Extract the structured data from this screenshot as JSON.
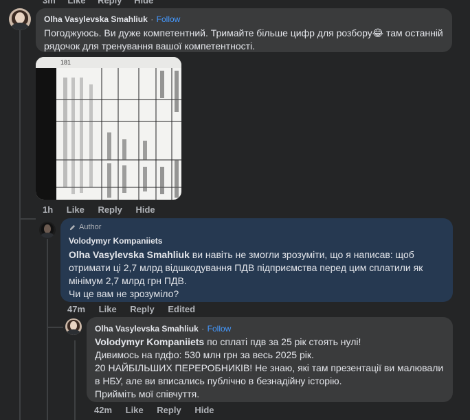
{
  "top_actions": [
    "3m",
    "Like",
    "Reply",
    "Hide"
  ],
  "comment1": {
    "author": "Olha Vasylevska Smahliuk",
    "sep": "·",
    "follow": "Follow",
    "text": "Погоджуюсь. Ви дуже компетентний. Тримайте більше цифр для розбору😂 там останній рядочок для тренування вашої компетентності.",
    "image_page_number": "181",
    "actions": {
      "time": "1h",
      "like": "Like",
      "reply": "Reply",
      "hide": "Hide"
    }
  },
  "reply1": {
    "badge": "Author",
    "author": "Volodymyr Kompaniiets",
    "mention": "Olha Vasylevska Smahliuk",
    "text": " ви навіть не змогли зрозуміти, що я написав: щоб отримати ці 2,7 млрд відшкодування ПДВ підприємства перед цим сплатили як мінімум 2,7 млрд грн ПДВ.",
    "text2": "Чи це вам не зрозуміло?",
    "actions": {
      "time": "47m",
      "like": "Like",
      "reply": "Reply",
      "edited": "Edited"
    }
  },
  "reply2": {
    "author": "Olha Vasylevska Smahliuk",
    "sep": "·",
    "follow": "Follow",
    "mention": "Volodymyr Kompaniiets",
    "line1": " по сплаті пдв за 25 рік стоять нулі!",
    "line2": "Дивимось на пдфо: 530 млн грн за весь 2025 рік.",
    "line3": "20 НАЙБІЛЬШИХ ПЕРЕРОБНИКІВ! Не знаю, які там презентації ви малювали в НБУ, але ви вписались публічно в безнадійну історію.",
    "line4": "Прийміть мої співчуття.",
    "actions": {
      "time": "42m",
      "like": "Like",
      "reply": "Reply",
      "hide": "Hide"
    }
  },
  "colors": {
    "background": "#242526",
    "bubble": "#3a3b3c",
    "author_bubble": "#263951",
    "follow_link": "#4599ff",
    "muted": "#b0b3b8"
  }
}
